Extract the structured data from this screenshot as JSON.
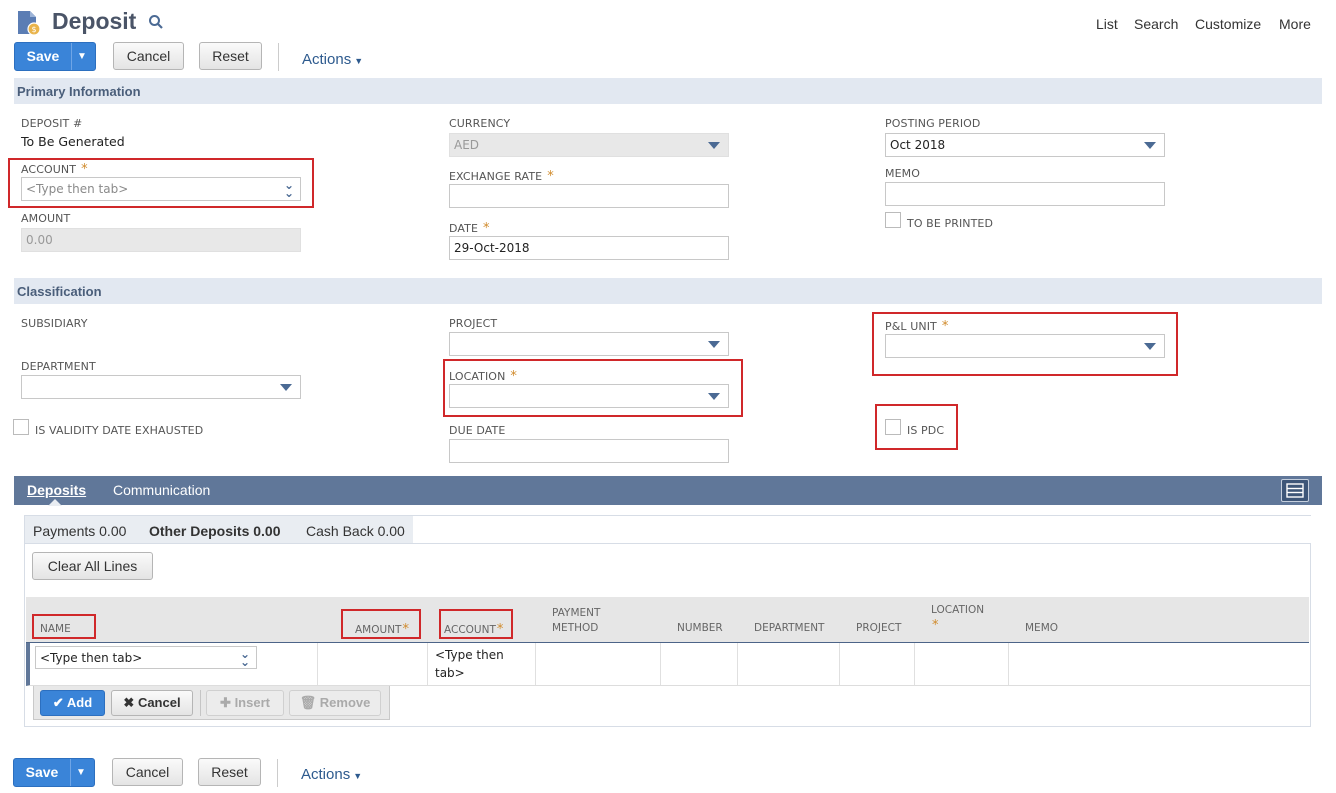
{
  "header": {
    "title": "Deposit",
    "links": [
      "List",
      "Search",
      "Customize",
      "More"
    ]
  },
  "toolbar": {
    "save": "Save",
    "cancel": "Cancel",
    "reset": "Reset",
    "actions": "Actions"
  },
  "primary": {
    "section": "Primary Information",
    "deposit_label": "DEPOSIT #",
    "deposit_value": "To Be Generated",
    "account_label": "ACCOUNT",
    "account_placeholder": "<Type then tab>",
    "amount_label": "AMOUNT",
    "amount_value": "0.00",
    "currency_label": "CURRENCY",
    "currency_value": "AED",
    "exchange_label": "EXCHANGE RATE",
    "date_label": "DATE",
    "date_value": "29-Oct-2018",
    "posting_label": "POSTING PERIOD",
    "posting_value": "Oct 2018",
    "memo_label": "MEMO",
    "to_be_printed": "TO BE PRINTED"
  },
  "classification": {
    "section": "Classification",
    "subsidiary": "SUBSIDIARY",
    "department": "DEPARTMENT",
    "validity": "IS VALIDITY DATE EXHAUSTED",
    "project": "PROJECT",
    "location": "LOCATION",
    "due_date": "DUE DATE",
    "pl_unit": "P&L UNIT",
    "is_pdc": "IS PDC"
  },
  "tabs": {
    "deposits": "Deposits",
    "communication": "Communication"
  },
  "subtabs": {
    "payments": "Payments 0.00",
    "other": "Other Deposits 0.00",
    "cashback": "Cash Back 0.00"
  },
  "grid": {
    "clear": "Clear All Lines",
    "cols": {
      "name": "NAME",
      "amount": "AMOUNT",
      "account": "ACCOUNT",
      "payment1": "PAYMENT",
      "payment2": "METHOD",
      "number": "NUMBER",
      "department": "DEPARTMENT",
      "project": "PROJECT",
      "location": "LOCATION",
      "memo": "MEMO"
    },
    "name_placeholder": "<Type then tab>",
    "account_cell1": "<Type then",
    "account_cell2": "tab>",
    "add": "Add",
    "cancel": "Cancel",
    "insert": "Insert",
    "remove": "Remove"
  },
  "colors": {
    "accent": "#3a84d8",
    "tabbar": "#607799",
    "section_bg": "#e2e8f1",
    "highlight": "#d0282a",
    "required": "#d08a2a"
  }
}
